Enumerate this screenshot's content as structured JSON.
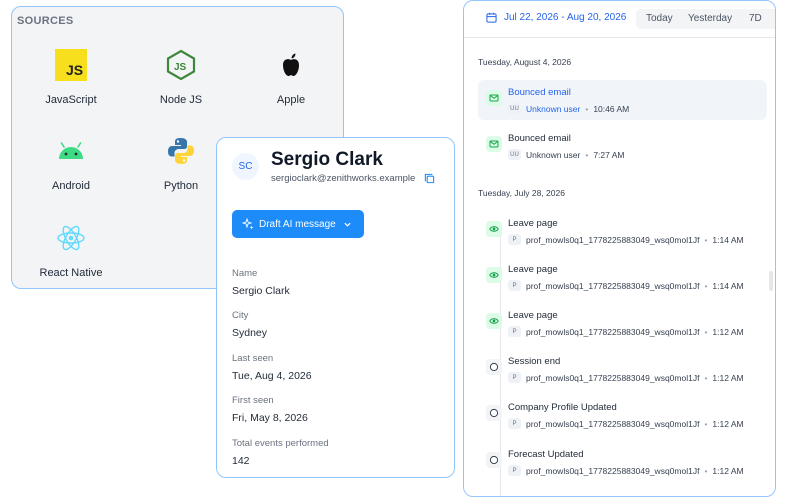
{
  "sources": {
    "title": "SOURCES",
    "items": [
      {
        "label": "JavaScript",
        "icon": "javascript-icon"
      },
      {
        "label": "Node JS",
        "icon": "nodejs-icon"
      },
      {
        "label": "Apple",
        "icon": "apple-icon"
      },
      {
        "label": "Android",
        "icon": "android-icon"
      },
      {
        "label": "Python",
        "icon": "python-icon"
      },
      {
        "label": "React Native",
        "icon": "react-icon"
      }
    ]
  },
  "profile": {
    "initials": "SC",
    "name": "Sergio Clark",
    "email": "sergioclark@zenithworks.example",
    "draft_button_label": "Draft AI message",
    "fields": [
      {
        "label": "Name",
        "value": "Sergio Clark"
      },
      {
        "label": "City",
        "value": "Sydney"
      },
      {
        "label": "Last seen",
        "value": "Tue, Aug 4, 2026"
      },
      {
        "label": "First seen",
        "value": "Fri, May 8, 2026"
      },
      {
        "label": "Total events performed",
        "value": "142"
      }
    ]
  },
  "activity": {
    "date_range": "Jul 22, 2026 - Aug 20, 2026",
    "quick_ranges": [
      "Today",
      "Yesterday",
      "7D"
    ],
    "day_groups": [
      {
        "date": "Tuesday, August 4, 2026",
        "events": [
          {
            "title": "Bounced email",
            "user_initials": "UU",
            "user": "Unknown user",
            "time": "10:46 AM"
          },
          {
            "title": "Bounced email",
            "user_initials": "UU",
            "user": "Unknown user",
            "time": "7:27 AM"
          }
        ]
      },
      {
        "date": "Tuesday, July 28, 2026",
        "events": [
          {
            "title": "Leave page",
            "user_initials": "P",
            "user": "prof_mowls0q1_1778225883049_wsq0mol1Jf",
            "time": "1:14 AM"
          },
          {
            "title": "Leave page",
            "user_initials": "P",
            "user": "prof_mowls0q1_1778225883049_wsq0mol1Jf",
            "time": "1:14 AM"
          },
          {
            "title": "Leave page",
            "user_initials": "P",
            "user": "prof_mowls0q1_1778225883049_wsq0mol1Jf",
            "time": "1:12 AM"
          },
          {
            "title": "Session end",
            "user_initials": "P",
            "user": "prof_mowls0q1_1778225883049_wsq0mol1Jf",
            "time": "1:12 AM"
          },
          {
            "title": "Company Profile Updated",
            "user_initials": "P",
            "user": "prof_mowls0q1_1778225883049_wsq0mol1Jf",
            "time": "1:12 AM"
          },
          {
            "title": "Forecast Updated",
            "user_initials": "P",
            "user": "prof_mowls0q1_1778225883049_wsq0mol1Jf",
            "time": "1:12 AM"
          }
        ]
      }
    ]
  },
  "colors": {
    "accent": "#1d8cf8",
    "link": "#2563eb",
    "card_border": "#93c5fd",
    "success_bg": "#dcfce7",
    "success_icon": "#16a34a"
  }
}
